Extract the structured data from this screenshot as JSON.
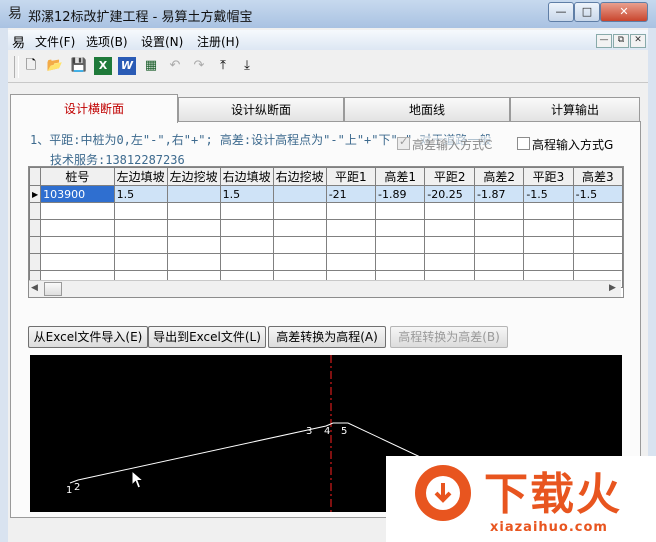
{
  "window": {
    "title": "郑漯12标改扩建工程 - 易算土方戴帽宝",
    "app_icon": "易",
    "minimize": "—",
    "maximize": "□",
    "close": "✕"
  },
  "menu": {
    "icon": "易",
    "items": [
      "文件(F)",
      "选项(B)",
      "设置(N)",
      "注册(H)"
    ],
    "mdi_min": "—",
    "mdi_restore": "⧉",
    "mdi_close": "✕"
  },
  "toolbar": {
    "icons": [
      "new-file-icon",
      "open-folder-icon",
      "save-icon",
      "excel-icon",
      "word-icon",
      "calculator-icon",
      "undo-icon",
      "redo-icon",
      "move-up-icon",
      "move-down-icon"
    ],
    "glyphs": [
      "🗋",
      "📂",
      "💾",
      "X",
      "W",
      "▦",
      "↶",
      "↷",
      "⤒",
      "⤓"
    ]
  },
  "tabs": [
    {
      "label": "设计横断面",
      "active": true
    },
    {
      "label": "设计纵断面",
      "active": false
    },
    {
      "label": "地面线",
      "active": false
    },
    {
      "label": "计算输出",
      "active": false
    }
  ],
  "hints": {
    "line1": "1、平距:中桩为0,左\"-\",右\"+\";  高差:设计高程点为\"-\"上\"+\"下\"-\" 对于道路一般",
    "line2": "技术服务:13812287236"
  },
  "options": {
    "height_diff_input": "高差输入方式C",
    "elevation_input": "高程输入方式G"
  },
  "grid": {
    "headers": [
      "桩号",
      "左边填坡",
      "左边挖坡",
      "右边填坡",
      "右边挖坡",
      "平距1",
      "高差1",
      "平距2",
      "高差2",
      "平距3",
      "高差3"
    ],
    "rows": [
      [
        "103900",
        "1.5",
        "",
        "1.5",
        "",
        "-21",
        "-1.89",
        "-20.25",
        "-1.87",
        "-1.5",
        "-1.5"
      ],
      [
        "",
        "",
        "",
        "",
        "",
        "",
        "",
        "",
        "",
        "",
        ""
      ],
      [
        "",
        "",
        "",
        "",
        "",
        "",
        "",
        "",
        "",
        "",
        ""
      ],
      [
        "",
        "",
        "",
        "",
        "",
        "",
        "",
        "",
        "",
        "",
        ""
      ],
      [
        "",
        "",
        "",
        "",
        "",
        "",
        "",
        "",
        "",
        "",
        ""
      ],
      [
        "",
        "",
        "",
        "",
        "",
        "",
        "",
        "",
        "",
        "",
        ""
      ]
    ]
  },
  "buttons": {
    "import_excel": "从Excel文件导入(E)",
    "export_excel": "导出到Excel文件(L)",
    "diff_to_elev": "高差转换为高程(A)",
    "elev_to_diff": "高程转换为高差(B)"
  },
  "cross_section": {
    "point_labels": [
      "1",
      "2",
      "3",
      "4",
      "5"
    ]
  },
  "watermark": {
    "brand": "下载火",
    "url": "xiazaihuo.com"
  },
  "colors": {
    "active_tab": "#c00000",
    "hint_text": "#3d6a8e",
    "selection": "#2f6fd0",
    "centerline": "#ff2020"
  }
}
